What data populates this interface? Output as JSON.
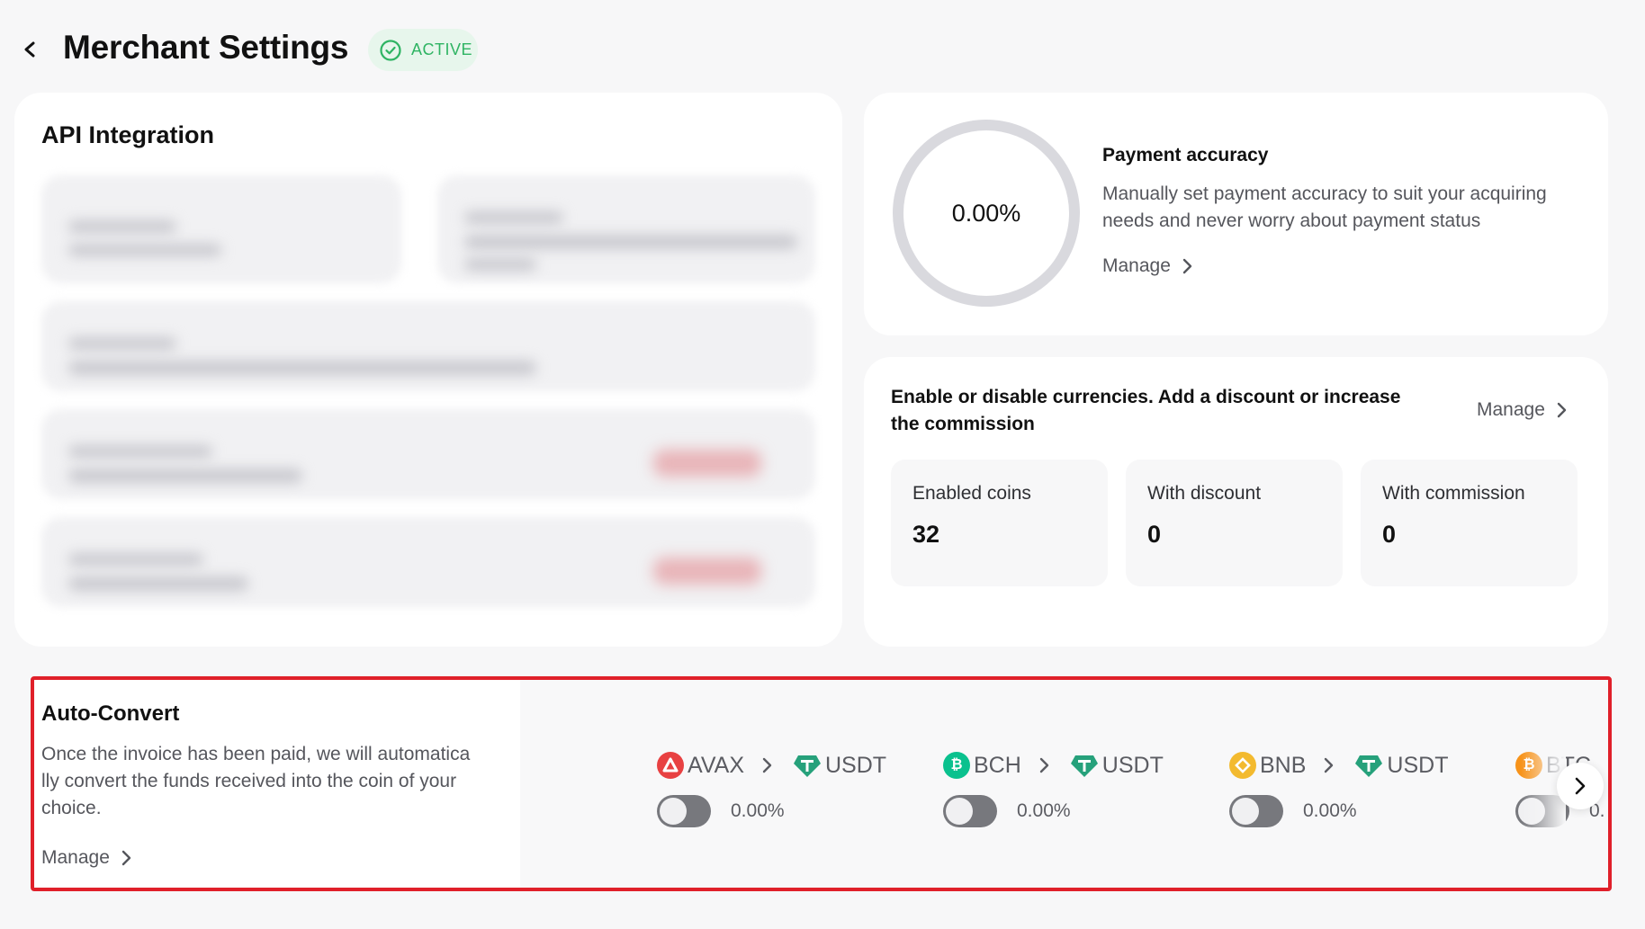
{
  "header": {
    "title": "Merchant Settings",
    "status": "ACTIVE"
  },
  "api": {
    "title": "API Integration"
  },
  "accuracy": {
    "value": "0.00%",
    "progress_fraction": 0,
    "title": "Payment accuracy",
    "description": "Manually set payment accuracy to suit your acquiring needs and never worry about payment status",
    "manage_label": "Manage"
  },
  "currencies": {
    "title": "Enable or disable currencies. Add a discount or increase the commission",
    "manage_label": "Manage",
    "stats": [
      {
        "label": "Enabled coins",
        "value": "32"
      },
      {
        "label": "With discount",
        "value": "0"
      },
      {
        "label": "With commission",
        "value": "0"
      }
    ]
  },
  "autoconvert": {
    "title": "Auto-Convert",
    "description": "Once the invoice has been paid, we will automatica lly convert the funds received into the coin of your choice.",
    "manage_label": "Manage",
    "pairs": [
      {
        "from": "AVAX",
        "from_icon": "avax-icon",
        "to": "USDT",
        "percent": "0.00%",
        "enabled": false
      },
      {
        "from": "BCH",
        "from_icon": "bch-icon",
        "to": "USDT",
        "percent": "0.00%",
        "enabled": false
      },
      {
        "from": "BNB",
        "from_icon": "bnb-icon",
        "to": "USDT",
        "percent": "0.00%",
        "enabled": false
      },
      {
        "from": "BTC",
        "from_icon": "btc-icon",
        "to": "",
        "percent": "0.",
        "enabled": false
      }
    ]
  },
  "colors": {
    "active_green": "#2fb463",
    "highlight_red": "#e0202a",
    "avax": "#e84142",
    "bch": "#0ac18e",
    "bnb": "#f3ba2f",
    "btc": "#f7931a",
    "usdt": "#26a17b"
  }
}
